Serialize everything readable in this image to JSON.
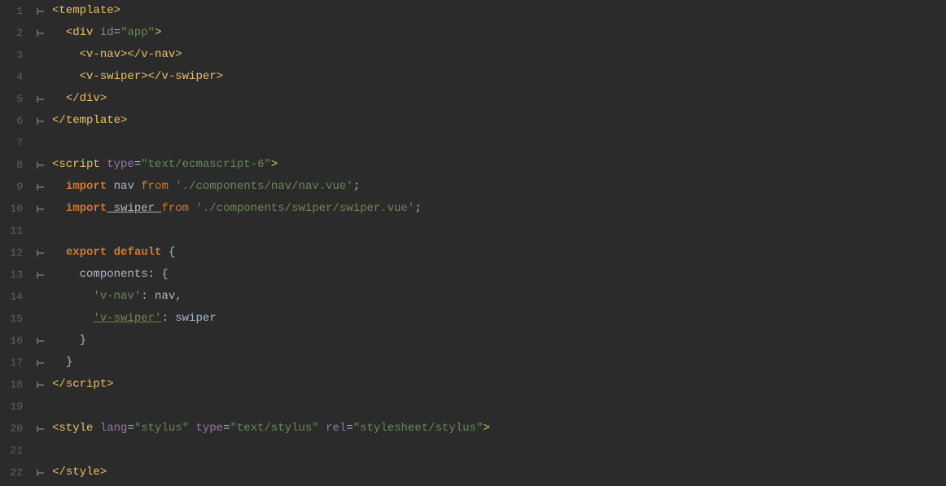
{
  "editor": {
    "background": "#2b2b2b",
    "lines": [
      {
        "number": "1",
        "fold": "⊢",
        "tokens": [
          {
            "type": "tag",
            "text": "<"
          },
          {
            "type": "tag-name",
            "text": "template"
          },
          {
            "type": "tag",
            "text": ">"
          }
        ]
      },
      {
        "number": "2",
        "fold": "⊢",
        "indent": 2,
        "tokens": [
          {
            "type": "tag",
            "text": "<"
          },
          {
            "type": "tag-name",
            "text": "div"
          },
          {
            "type": "attr-name",
            "text": " id"
          },
          {
            "type": "attr-eq",
            "text": "="
          },
          {
            "type": "attr-value",
            "text": "\"app\""
          },
          {
            "type": "tag",
            "text": ">"
          }
        ]
      },
      {
        "number": "3",
        "fold": "",
        "indent": 4,
        "tokens": [
          {
            "type": "tag",
            "text": "<"
          },
          {
            "type": "tag-name",
            "text": "v-nav"
          },
          {
            "type": "tag",
            "text": "></"
          },
          {
            "type": "tag-name",
            "text": "v-nav"
          },
          {
            "type": "tag",
            "text": ">"
          }
        ]
      },
      {
        "number": "4",
        "fold": "",
        "indent": 4,
        "tokens": [
          {
            "type": "tag",
            "text": "<"
          },
          {
            "type": "tag-name",
            "text": "v-swiper"
          },
          {
            "type": "tag",
            "text": "></"
          },
          {
            "type": "tag-name",
            "text": "v-swiper"
          },
          {
            "type": "tag",
            "text": ">"
          }
        ]
      },
      {
        "number": "5",
        "fold": "⊢",
        "indent": 2,
        "tokens": [
          {
            "type": "tag",
            "text": "</"
          },
          {
            "type": "tag-name",
            "text": "div"
          },
          {
            "type": "tag",
            "text": ">"
          }
        ]
      },
      {
        "number": "6",
        "fold": "⊢",
        "indent": 0,
        "tokens": [
          {
            "type": "tag",
            "text": "</"
          },
          {
            "type": "tag-name",
            "text": "template"
          },
          {
            "type": "tag",
            "text": ">"
          }
        ]
      },
      {
        "number": "7",
        "fold": "",
        "indent": 0,
        "tokens": []
      },
      {
        "number": "8",
        "fold": "⊢",
        "indent": 0,
        "tokens": [
          {
            "type": "tag",
            "text": "<"
          },
          {
            "type": "tag-name",
            "text": "script"
          },
          {
            "type": "attr-name",
            "text": " type"
          },
          {
            "type": "attr-eq",
            "text": "="
          },
          {
            "type": "attr-value",
            "text": "\"text/ecmascript-6\""
          },
          {
            "type": "tag",
            "text": ">"
          }
        ]
      },
      {
        "number": "9",
        "fold": "⊢",
        "indent": 2,
        "tokens": [
          {
            "type": "keyword",
            "text": "import"
          },
          {
            "type": "var-name",
            "text": " nav "
          },
          {
            "type": "from-kw",
            "text": "from"
          },
          {
            "type": "string",
            "text": " './components/nav/nav.vue'"
          },
          {
            "type": "punctuation",
            "text": ";"
          }
        ]
      },
      {
        "number": "10",
        "fold": "⊢",
        "indent": 2,
        "tokens": [
          {
            "type": "keyword",
            "text": "import"
          },
          {
            "type": "import-name-underline",
            "text": " swiper "
          },
          {
            "type": "from-kw",
            "text": "from"
          },
          {
            "type": "string",
            "text": " './components/swiper/swiper.vue'"
          },
          {
            "type": "punctuation",
            "text": ";"
          }
        ]
      },
      {
        "number": "11",
        "fold": "",
        "indent": 0,
        "tokens": []
      },
      {
        "number": "12",
        "fold": "⊢",
        "indent": 2,
        "tokens": [
          {
            "type": "keyword",
            "text": "export"
          },
          {
            "type": "keyword",
            "text": " default"
          },
          {
            "type": "brace",
            "text": " {"
          }
        ]
      },
      {
        "number": "13",
        "fold": "⊢",
        "indent": 4,
        "tokens": [
          {
            "type": "prop-name",
            "text": "components"
          },
          {
            "type": "punctuation",
            "text": ": {"
          }
        ]
      },
      {
        "number": "14",
        "fold": "",
        "indent": 6,
        "tokens": [
          {
            "type": "string",
            "text": "'v-nav'"
          },
          {
            "type": "punctuation",
            "text": ": "
          },
          {
            "type": "component-val",
            "text": "nav,"
          }
        ]
      },
      {
        "number": "15",
        "fold": "",
        "indent": 6,
        "tokens": [
          {
            "type": "string-underline",
            "text": "'v-swiper'"
          },
          {
            "type": "punctuation",
            "text": ": "
          },
          {
            "type": "component-val",
            "text": "swiper"
          }
        ]
      },
      {
        "number": "16",
        "fold": "⊢",
        "indent": 4,
        "tokens": [
          {
            "type": "brace",
            "text": "}"
          }
        ]
      },
      {
        "number": "17",
        "fold": "⊢",
        "indent": 2,
        "tokens": [
          {
            "type": "brace",
            "text": "}"
          }
        ]
      },
      {
        "number": "18",
        "fold": "⊢",
        "indent": 0,
        "tokens": [
          {
            "type": "tag",
            "text": "</"
          },
          {
            "type": "tag-name",
            "text": "script"
          },
          {
            "type": "tag",
            "text": ">"
          }
        ]
      },
      {
        "number": "19",
        "fold": "",
        "indent": 0,
        "tokens": []
      },
      {
        "number": "20",
        "fold": "⊢",
        "indent": 0,
        "tokens": [
          {
            "type": "tag",
            "text": "<"
          },
          {
            "type": "tag-name",
            "text": "style"
          },
          {
            "type": "attr-name",
            "text": " lang"
          },
          {
            "type": "attr-eq",
            "text": "="
          },
          {
            "type": "attr-value",
            "text": "\"stylus\""
          },
          {
            "type": "attr-name",
            "text": " type"
          },
          {
            "type": "attr-eq",
            "text": "="
          },
          {
            "type": "attr-value",
            "text": "\"text/stylus\""
          },
          {
            "type": "attr-name",
            "text": " rel"
          },
          {
            "type": "attr-eq",
            "text": "="
          },
          {
            "type": "attr-value",
            "text": "\"stylesheet/stylus\""
          },
          {
            "type": "tag",
            "text": ">"
          }
        ]
      },
      {
        "number": "21",
        "fold": "",
        "indent": 0,
        "tokens": []
      },
      {
        "number": "22",
        "fold": "⊢",
        "indent": 0,
        "tokens": [
          {
            "type": "tag",
            "text": "</"
          },
          {
            "type": "tag-name",
            "text": "style"
          },
          {
            "type": "tag",
            "text": ">"
          }
        ]
      }
    ]
  }
}
